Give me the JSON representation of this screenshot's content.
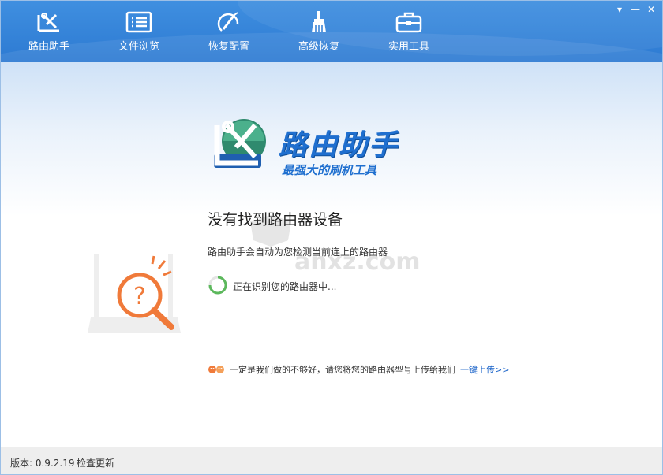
{
  "toolbar": {
    "items": [
      {
        "label": "路由助手",
        "icon": "router-tools-icon"
      },
      {
        "label": "文件浏览",
        "icon": "file-list-icon"
      },
      {
        "label": "恢复配置",
        "icon": "restore-icon"
      },
      {
        "label": "高级恢复",
        "icon": "brush-icon"
      },
      {
        "label": "实用工具",
        "icon": "toolbox-icon"
      }
    ],
    "menu_symbol": "▾",
    "minimize_symbol": "—",
    "close_symbol": "✕"
  },
  "logo": {
    "title": "路由助手",
    "subtitle": "最强大的刷机工具"
  },
  "main": {
    "heading": "没有找到路由器设备",
    "description": "路由助手会自动为您检测当前连上的路由器",
    "status": "正在识别您的路由器中..."
  },
  "watermark": {
    "text": "anxz.com"
  },
  "feedback": {
    "text": "一定是我们做的不够好，请您将您的路由器型号上传给我们",
    "link": "一键上传>>"
  },
  "footer": {
    "version": "版本: 0.9.2.19",
    "update": "检查更新"
  },
  "colors": {
    "toolbar": "#2d7ad2",
    "accent": "#1a63c9",
    "orange": "#f07a3a",
    "green": "#5cb85c"
  }
}
